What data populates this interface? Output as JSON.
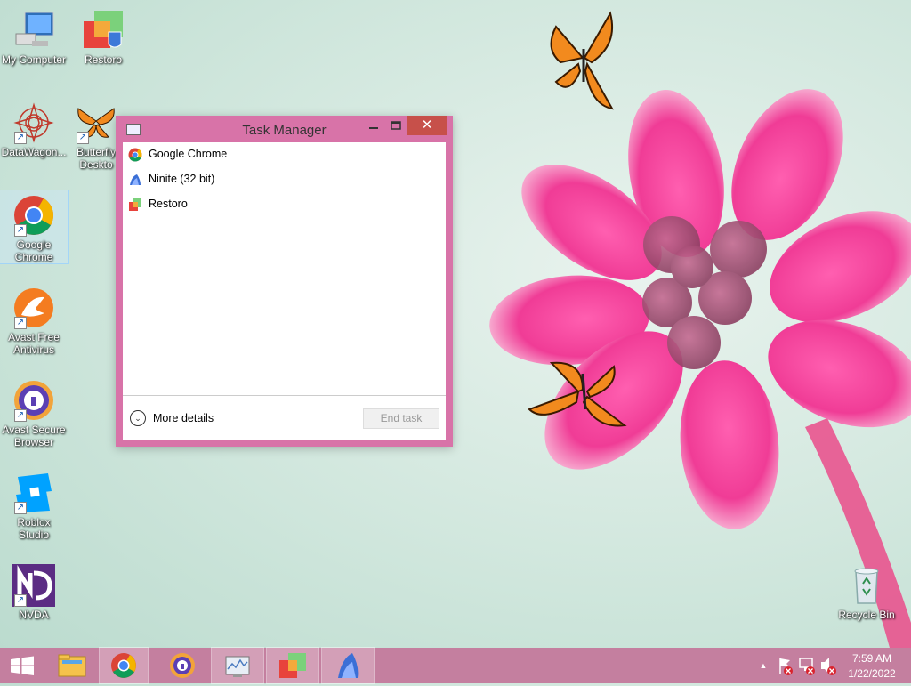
{
  "desktop": {
    "icons": [
      {
        "label": "My Computer",
        "icon": "computer-icon"
      },
      {
        "label": "Restoro",
        "icon": "restoro-icon"
      },
      {
        "label": "DataWagon...",
        "icon": "datawagon-icon"
      },
      {
        "label": "Butterfly Deskto",
        "icon": "butterfly-icon"
      },
      {
        "label": "Google Chrome",
        "icon": "chrome-icon"
      },
      {
        "label": "Avast Free Antivirus",
        "icon": "avast-icon"
      },
      {
        "label": "Avast Secure Browser",
        "icon": "avast-browser-icon"
      },
      {
        "label": "Roblox Studio",
        "icon": "roblox-studio-icon"
      },
      {
        "label": "NVDA",
        "icon": "nvda-icon"
      },
      {
        "label": "Recycle Bin",
        "icon": "recycle-bin-icon"
      }
    ]
  },
  "task_manager": {
    "title": "Task Manager",
    "close_glyph": "✕",
    "processes": [
      {
        "name": "Google Chrome",
        "icon": "chrome-icon"
      },
      {
        "name": "Ninite (32 bit)",
        "icon": "ninite-icon"
      },
      {
        "name": "Restoro",
        "icon": "restoro-icon"
      }
    ],
    "more_details_label": "More details",
    "more_details_glyph": "⌄",
    "end_task_label": "End task"
  },
  "taskbar": {
    "items": [
      "start-icon",
      "file-explorer-icon",
      "chrome-icon",
      "avast-browser-icon",
      "task-manager-icon",
      "restoro-icon",
      "ninite-icon"
    ],
    "tray_expand_glyph": "▲",
    "time": "7:59 AM",
    "date": "1/22/2022"
  },
  "colors": {
    "window_frame": "#d873a8",
    "taskbar": "#c47f9f",
    "close_button": "#c7504a"
  }
}
